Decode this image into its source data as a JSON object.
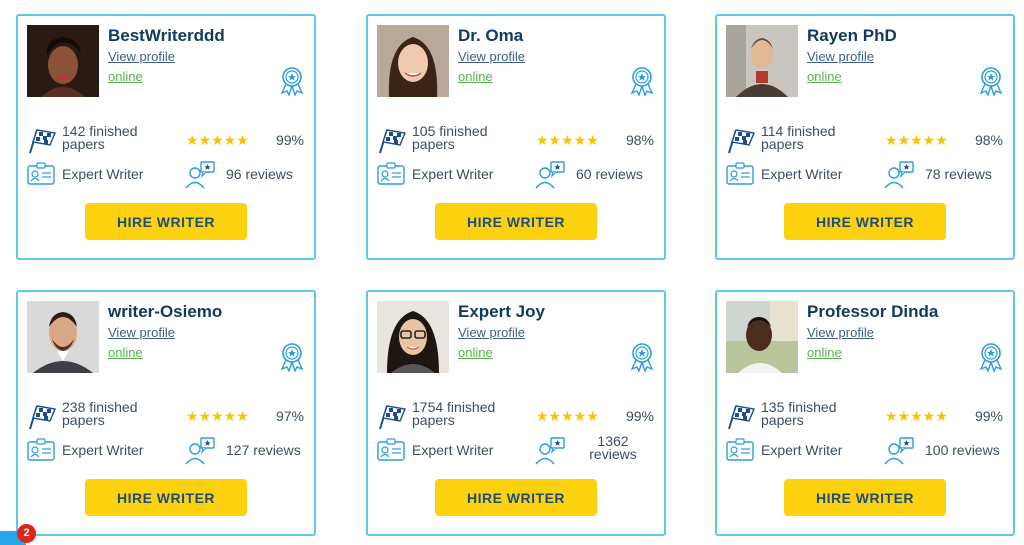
{
  "common": {
    "view_profile": "View profile",
    "online": "online",
    "hire_label": "HIRE WRITER",
    "stars": "★★★★★",
    "star_color": "#f5c500",
    "button_color": "#fcd20f",
    "border_color": "#5ec8ec"
  },
  "writers": [
    {
      "name": "BestWriterddd",
      "papers": "142 finished papers",
      "rating": "99%",
      "level": "Expert Writer",
      "reviews": "96 reviews"
    },
    {
      "name": "Dr. Oma",
      "papers": "105 finished papers",
      "rating": "98%",
      "level": "Expert Writer",
      "reviews": "60 reviews"
    },
    {
      "name": "Rayen PhD",
      "papers": "114 finished papers",
      "rating": "98%",
      "level": "Expert Writer",
      "reviews": "78 reviews"
    },
    {
      "name": "writer-Osiemo",
      "papers": "238 finished papers",
      "rating": "97%",
      "level": "Expert Writer",
      "reviews": "127 reviews"
    },
    {
      "name": "Expert Joy",
      "papers": "1754 finished papers",
      "rating": "99%",
      "level": "Expert Writer",
      "reviews": "1362 reviews"
    },
    {
      "name": "Professor Dinda",
      "papers": "135 finished papers",
      "rating": "99%",
      "level": "Expert Writer",
      "reviews": "100 reviews"
    }
  ],
  "chat": {
    "badge_count": "2"
  },
  "icons": {
    "award": "award-badge-icon",
    "flag": "checkered-flag-icon",
    "id": "id-card-icon",
    "reviews": "reviewer-icon"
  }
}
